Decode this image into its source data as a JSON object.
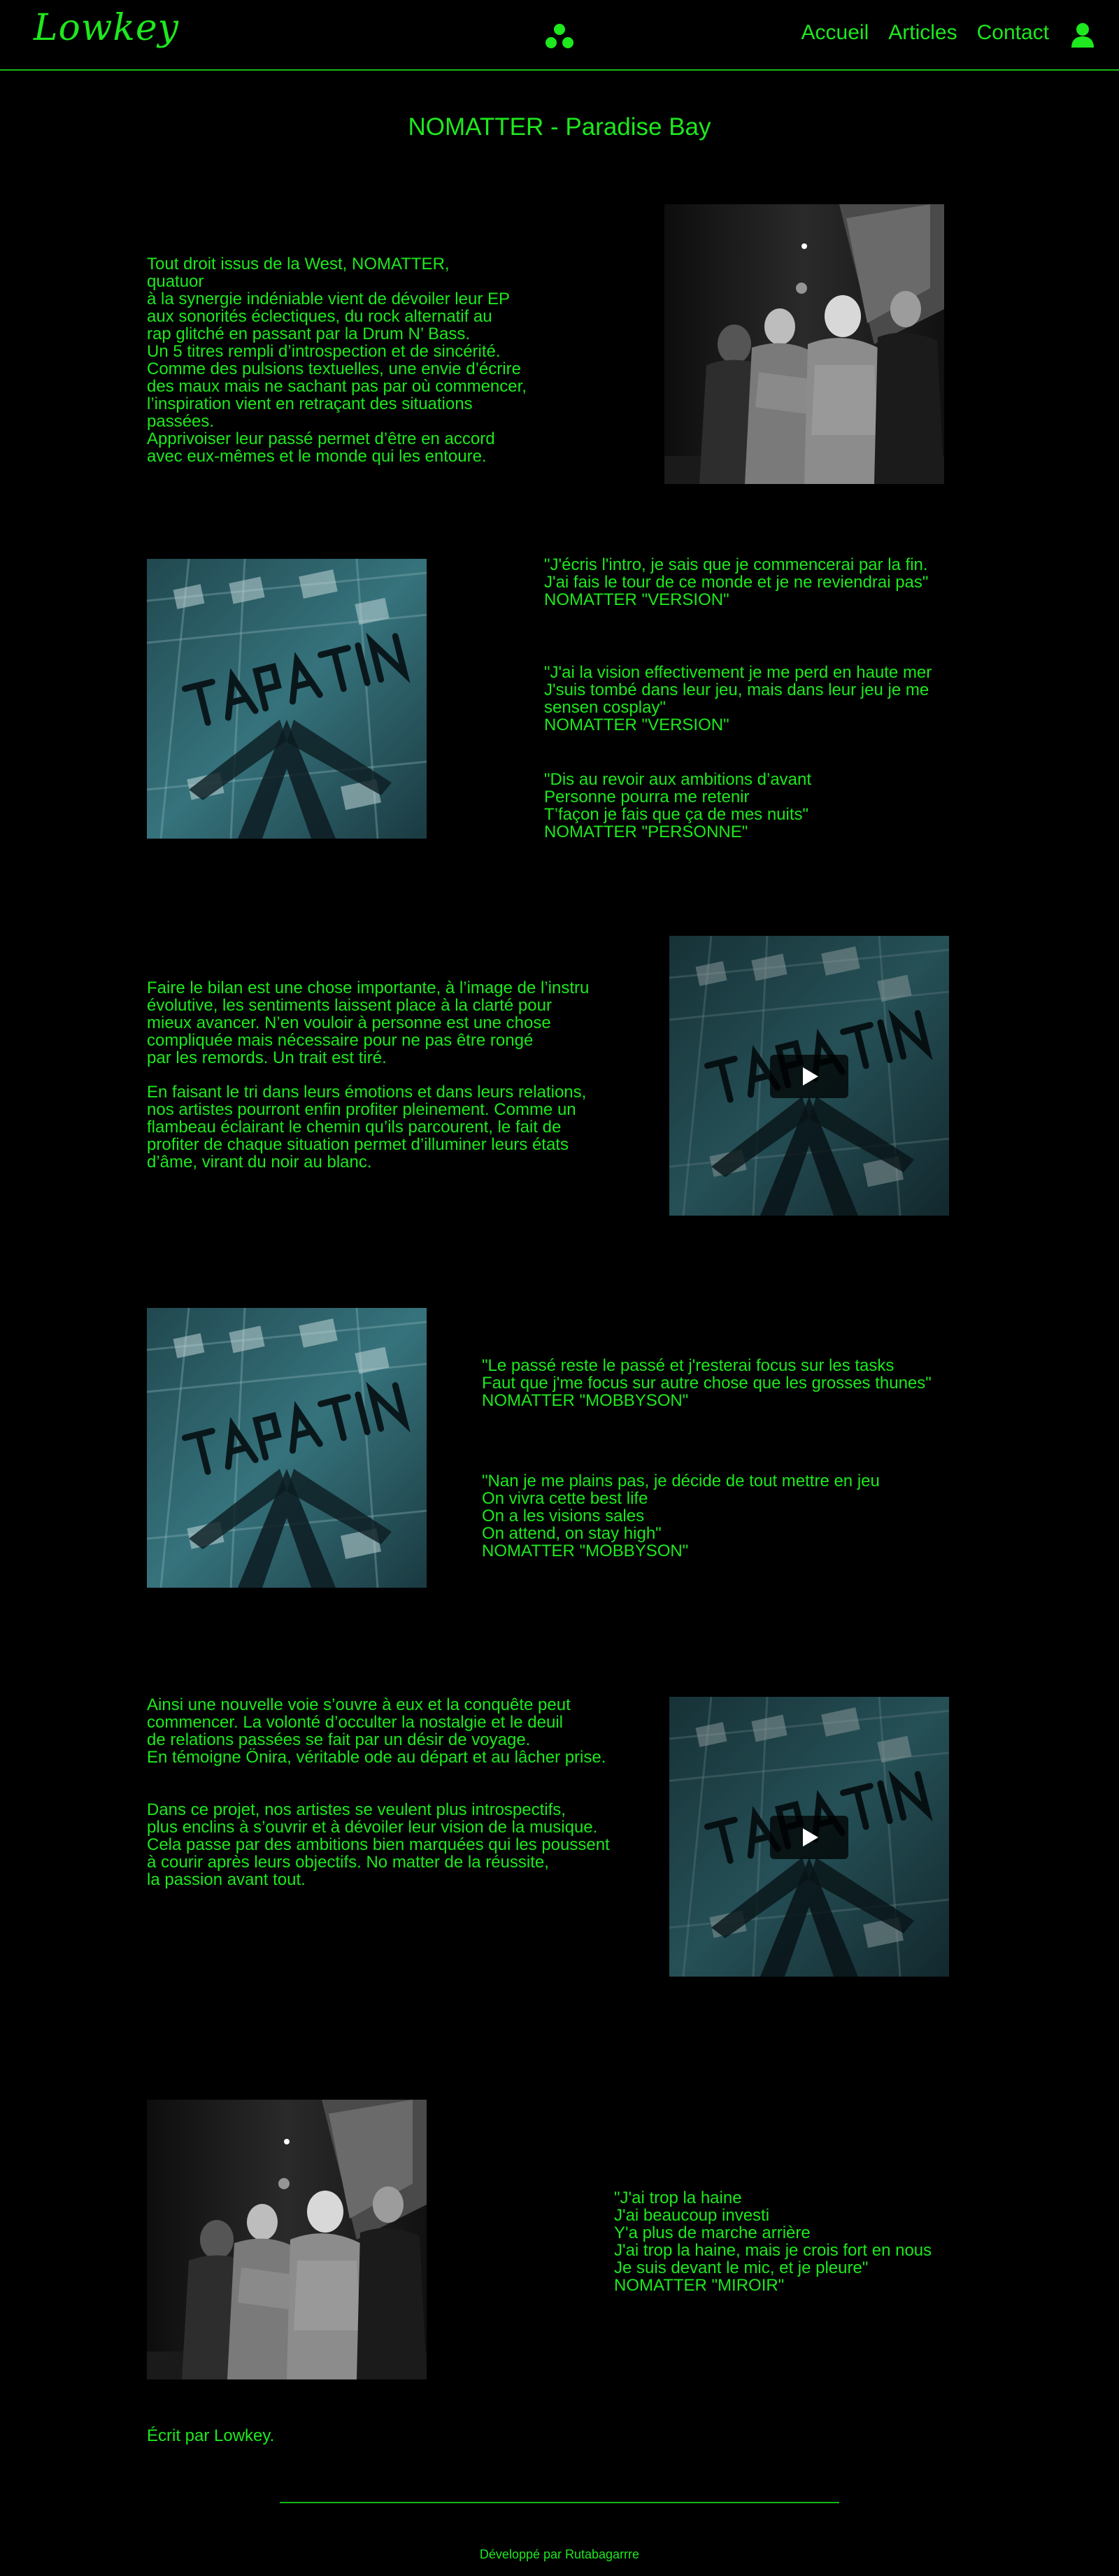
{
  "header": {
    "logo": "Lowkey",
    "nav": [
      "Accueil",
      "Articles",
      "Contact"
    ]
  },
  "article": {
    "title": "NOMATTER - Paradise Bay",
    "intro": [
      "Tout droit issus de la West, NOMATTER, quatuor\nà la synergie indéniable vient de dévoiler leur EP\naux sonorités éclectiques, du rock alternatif au\nrap glitché en passant par la Drum N’ Bass.\nUn 5 titres rempli d’introspection et de sincérité.",
      "Comme des pulsions textuelles, une envie d’écrire\ndes maux mais ne sachant pas par où commencer,\nl’inspiration vient en retraçant des situations passées.\nApprivoiser leur passé permet d’être en accord\navec eux-mêmes et le monde qui les entoure."
    ],
    "quotes1": [
      "\"J'écris l'intro, je sais que je commencerai par la fin.\nJ'ai fais le tour de ce monde et je ne reviendrai pas\"\nNOMATTER \"VERSION\"",
      "\"J'ai la vision effectivement je me perd en haute mer\nJ'suis tombé dans leur jeu, mais dans leur jeu je me\nsensen cosplay\"\nNOMATTER \"VERSION\"",
      "\"Dis au revoir aux ambitions d’avant\nPersonne pourra me retenir\nT’façon je fais que ça de mes nuits\"\nNOMATTER \"PERSONNE\""
    ],
    "para2": [
      "Faire le bilan est une chose importante, à l’image de l’instru\névolutive, les sentiments laissent place à la clarté pour\nmieux avancer. N’en vouloir à personne est une chose\ncompliquée mais nécessaire pour ne pas être rongé\npar les remords. Un trait est tiré.",
      "En faisant le tri dans leurs émotions et dans leurs relations,\nnos artistes pourront enfin profiter pleinement. Comme un\nflambeau éclairant le chemin qu’ils parcourent, le fait de\nprofiter de chaque situation permet d’illuminer leurs états\nd’âme, virant du noir au blanc."
    ],
    "quotes2": [
      "\"Le passé reste le passé et j'resterai focus sur les tasks\nFaut que j'me focus sur autre chose que les grosses thunes\"\nNOMATTER \"MOBBYSON\"",
      "\"Nan je me plains pas, je décide de tout mettre en jeu\nOn vivra cette best life\nOn a les visions sales\nOn attend, on stay high\"\nNOMATTER \"MOBBYSON\""
    ],
    "para3": [
      "Ainsi une nouvelle voie s’ouvre à eux et la conquête peut\ncommencer. La volonté d’occulter la nostalgie et le deuil\nde relations passées se fait par un désir de voyage.\nEn témoigne Önira, véritable ode au départ et au lâcher prise.",
      "Dans ce projet, nos artistes se veulent plus introspectifs,\nplus enclins à s’ouvrir et à dévoiler leur vision de la musique.\nCela passe par des ambitions bien marquées qui les poussent\nà courir après leurs objectifs. No matter de la réussite,\nla passion avant tout."
    ],
    "quote3": "\"J'ai trop la haine\nJ'ai beaucoup investi\nY'a plus de marche arrière\nJ'ai trop la haine, mais je crois fort en nous\nJe suis devant le mic, et je pleure\"\nNOMATTER \"MIROIR\"",
    "author": "Écrit par Lowkey."
  },
  "footer": {
    "credit": "Développé par Rutabagarrre"
  },
  "colors": {
    "accent": "#1ee81e",
    "background": "#000000",
    "cover": "#2d6f78"
  },
  "icons": [
    "three-dots-icon",
    "user-icon",
    "play-icon"
  ]
}
